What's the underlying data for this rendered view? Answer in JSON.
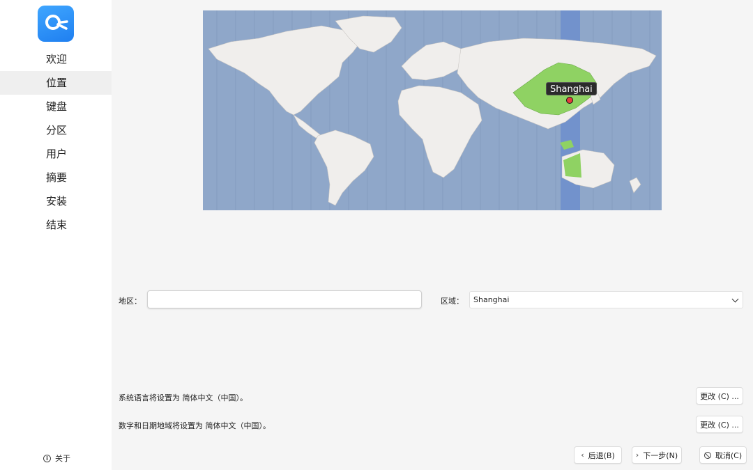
{
  "colors": {
    "sidebar_bg": "#ffffff",
    "active_item_bg": "#efefef",
    "ocean": "#8fa7c9",
    "land": "#f0eeec",
    "timezone_band": "#6f90cc",
    "highlight_country": "#8fd263",
    "pin": "#e43c3c"
  },
  "sidebar": {
    "logo_icon": "installer-logo-icon",
    "items": [
      {
        "label": "欢迎",
        "active": false
      },
      {
        "label": "位置",
        "active": true
      },
      {
        "label": "键盘",
        "active": false
      },
      {
        "label": "分区",
        "active": false
      },
      {
        "label": "用户",
        "active": false
      },
      {
        "label": "摘要",
        "active": false
      },
      {
        "label": "安装",
        "active": false
      },
      {
        "label": "结束",
        "active": false
      }
    ],
    "about_label": "关于",
    "about_icon": "info-icon"
  },
  "map": {
    "selected_city": "Shanghai"
  },
  "region": {
    "label": "地区：",
    "value": ""
  },
  "zone": {
    "label": "区域：",
    "value": "Shanghai"
  },
  "language_info": {
    "text": "系统语言将设置为 简体中文（中国）。",
    "change_label": "更改 (C) ..."
  },
  "locale_info": {
    "text": "数字和日期地域将设置为 简体中文（中国）。",
    "change_label": "更改 (C) ..."
  },
  "footer": {
    "back_label": "后退(B)",
    "next_label": "下一步(N)",
    "cancel_label": "取消(C)"
  }
}
